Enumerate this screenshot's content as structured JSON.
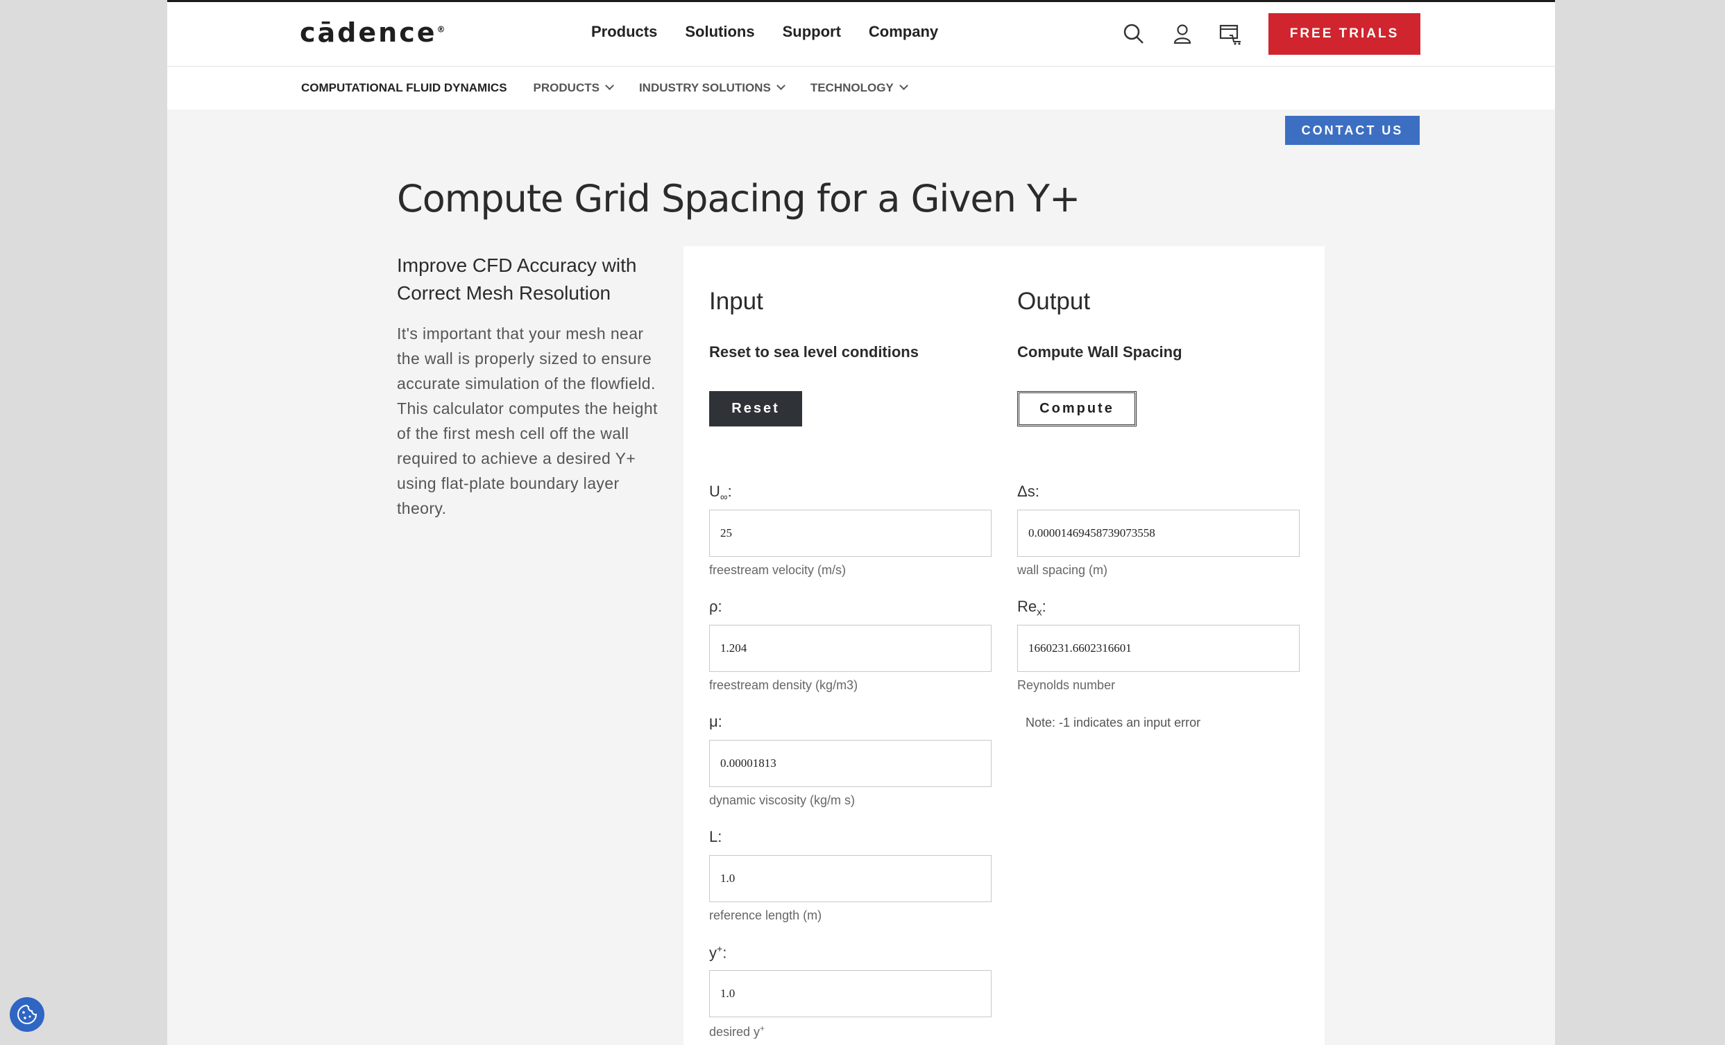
{
  "header": {
    "logo": "cādence",
    "logo_mark": "®",
    "menu": [
      "Products",
      "Solutions",
      "Support",
      "Company"
    ],
    "free_trials_label": "FREE TRIALS"
  },
  "subnav": {
    "items": [
      "COMPUTATIONAL FLUID DYNAMICS",
      "PRODUCTS",
      "INDUSTRY SOLUTIONS",
      "TECHNOLOGY"
    ]
  },
  "contact_label": "CONTACT US",
  "page_title": "Compute Grid Spacing for a Given  Y+",
  "intro": {
    "title": "Improve CFD Accuracy with Correct Mesh Resolution",
    "text": "It's important that your mesh near the wall is properly sized to ensure accurate simulation of the flowfield. This calculator computes the height of the first mesh cell off the wall required to achieve a desired Y+ using flat-plate boundary layer theory."
  },
  "input": {
    "heading": "Input",
    "subhead": "Reset to sea level conditions",
    "reset_label": "Reset",
    "fields": [
      {
        "label": "U",
        "label_sub": "∞",
        "label_tail": ":",
        "value": "25",
        "hint": "freestream velocity (m/s)"
      },
      {
        "label": "ρ:",
        "value": "1.204",
        "hint": "freestream density (kg/m3)"
      },
      {
        "label": "μ:",
        "value": "0.00001813",
        "hint": "dynamic viscosity (kg/m s)"
      },
      {
        "label": "L:",
        "value": "1.0",
        "hint": "reference length (m)"
      },
      {
        "label": "y",
        "label_sup": "+",
        "label_tail": ":",
        "value": "1.0",
        "hint": "desired y",
        "hint_sup": "+"
      }
    ]
  },
  "output": {
    "heading": "Output",
    "subhead": "Compute Wall Spacing",
    "compute_label": "Compute",
    "fields": [
      {
        "label": "Δs:",
        "value": "0.00001469458739073558",
        "hint": "wall spacing (m)"
      },
      {
        "label": "Re",
        "label_sub": "x",
        "label_tail": ":",
        "value": "1660231.6602316601",
        "hint": "Reynolds number"
      }
    ],
    "note": "Note: -1 indicates an input error"
  },
  "icons": [
    "search-icon",
    "user-icon",
    "cart-icon",
    "cookie-icon"
  ]
}
